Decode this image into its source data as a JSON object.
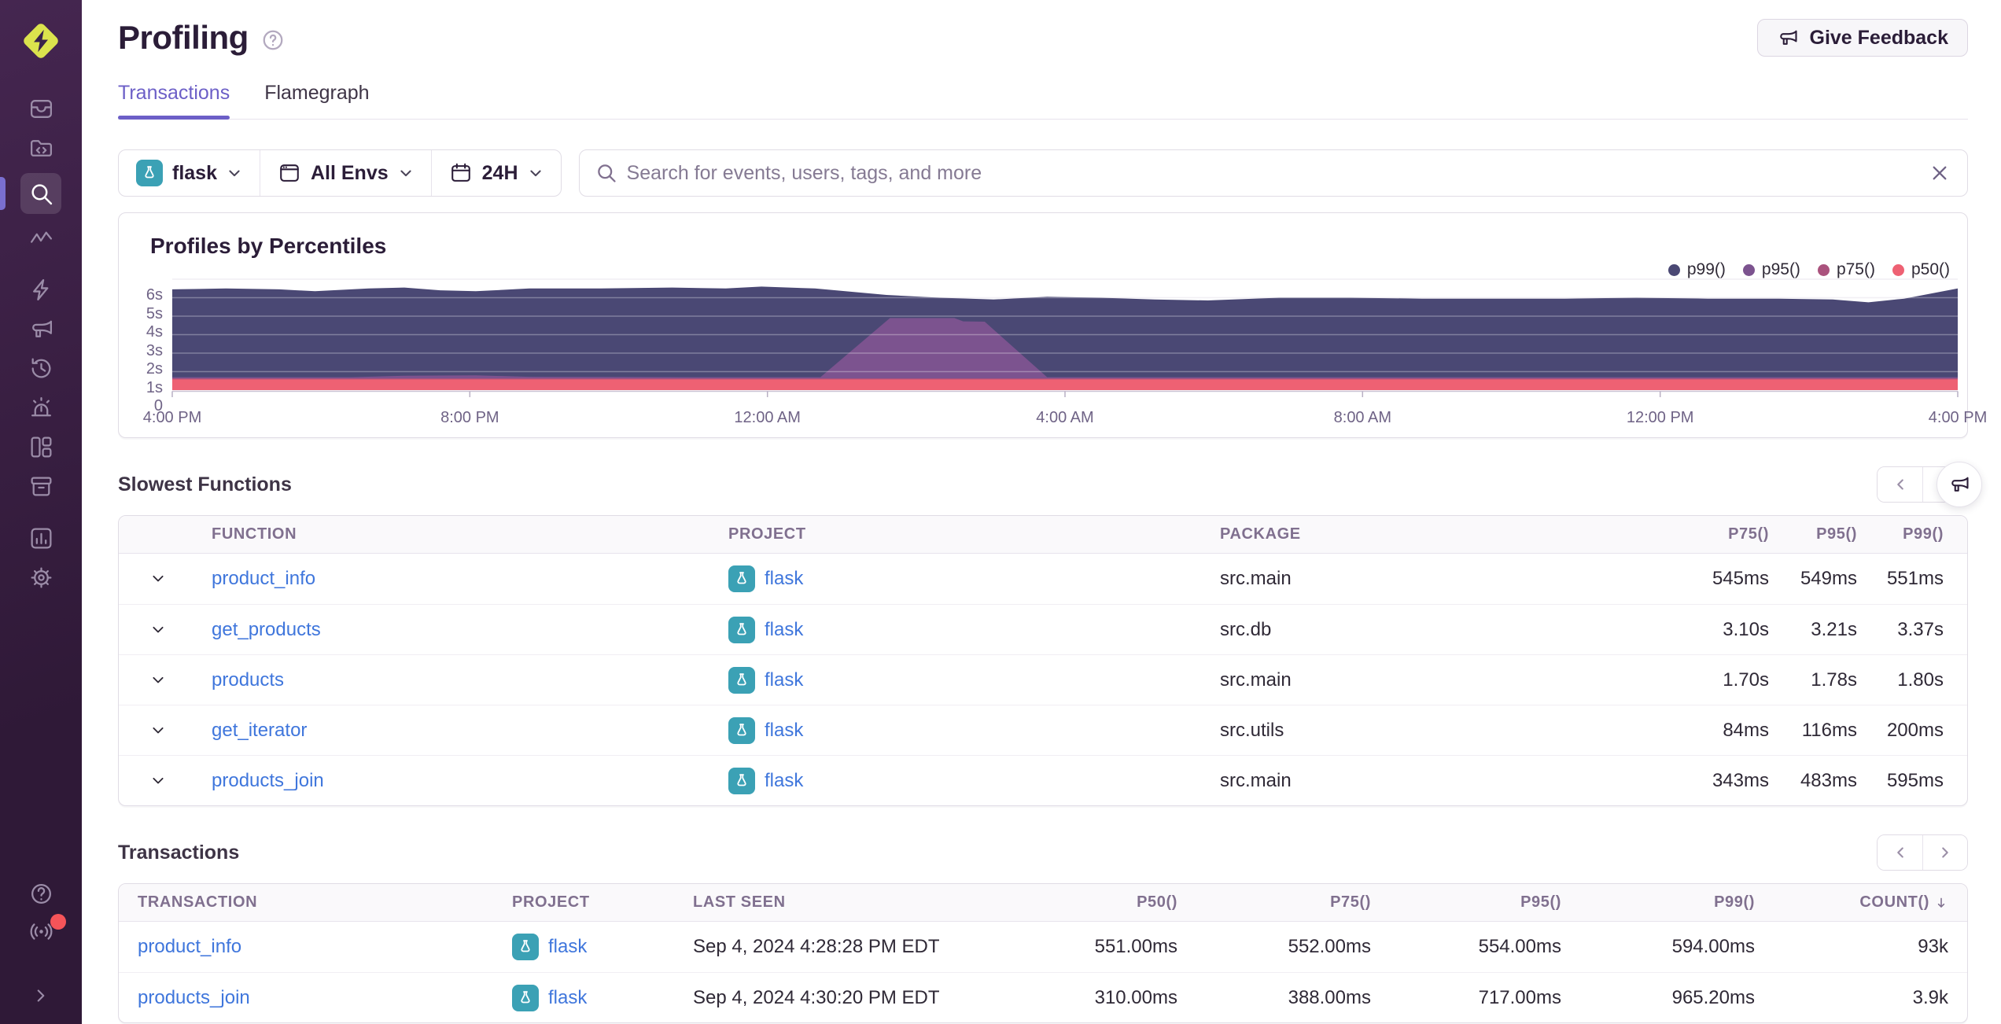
{
  "header": {
    "title": "Profiling",
    "feedback_button": "Give Feedback"
  },
  "tabs": [
    {
      "label": "Transactions",
      "active": true
    },
    {
      "label": "Flamegraph",
      "active": false
    }
  ],
  "filters": {
    "project": "flask",
    "environment": "All Envs",
    "date_range": "24H"
  },
  "search": {
    "placeholder": "Search for events, users, tags, and more"
  },
  "panel": {
    "title": "Profiles by Percentiles"
  },
  "chart_data": {
    "type": "area",
    "title": "Profiles by Percentiles",
    "x_window": "24 hours, 4:00 PM to 4:00 PM",
    "x_ticks": [
      "4:00 PM",
      "8:00 PM",
      "12:00 AM",
      "4:00 AM",
      "8:00 AM",
      "12:00 PM",
      "4:00 PM"
    ],
    "y_ticks": [
      "0",
      "1s",
      "2s",
      "3s",
      "4s",
      "5s",
      "6s"
    ],
    "ylim": [
      0,
      6.3
    ],
    "grid": true,
    "legend_position": "top-right",
    "series": [
      {
        "name": "p99()",
        "color": "#4a4874",
        "pattern": false,
        "points": [
          [
            0,
            5.45
          ],
          [
            0.03,
            5.5
          ],
          [
            0.06,
            5.45
          ],
          [
            0.08,
            5.35
          ],
          [
            0.11,
            5.5
          ],
          [
            0.13,
            5.55
          ],
          [
            0.15,
            5.4
          ],
          [
            0.17,
            5.35
          ],
          [
            0.2,
            5.5
          ],
          [
            0.24,
            5.5
          ],
          [
            0.28,
            5.55
          ],
          [
            0.31,
            5.5
          ],
          [
            0.33,
            5.6
          ],
          [
            0.36,
            5.5
          ],
          [
            0.4,
            5.15
          ],
          [
            0.43,
            5.0
          ],
          [
            0.46,
            4.9
          ],
          [
            0.49,
            5.05
          ],
          [
            0.52,
            5.0
          ],
          [
            0.55,
            4.9
          ],
          [
            0.58,
            4.85
          ],
          [
            0.62,
            5.0
          ],
          [
            0.66,
            5.0
          ],
          [
            0.7,
            4.95
          ],
          [
            0.74,
            4.95
          ],
          [
            0.78,
            4.95
          ],
          [
            0.82,
            5.0
          ],
          [
            0.86,
            4.95
          ],
          [
            0.9,
            4.95
          ],
          [
            0.93,
            4.9
          ],
          [
            0.95,
            4.75
          ],
          [
            0.97,
            4.95
          ],
          [
            1,
            5.5
          ]
        ]
      },
      {
        "name": "p95()",
        "color": "#7c538f",
        "pattern": false,
        "points": [
          [
            0,
            0.7
          ],
          [
            0.1,
            0.7
          ],
          [
            0.13,
            0.78
          ],
          [
            0.17,
            0.8
          ],
          [
            0.2,
            0.72
          ],
          [
            0.3,
            0.7
          ],
          [
            0.363,
            0.7
          ],
          [
            0.402,
            3.9
          ],
          [
            0.438,
            3.9
          ],
          [
            0.443,
            3.72
          ],
          [
            0.455,
            3.7
          ],
          [
            0.49,
            0.7
          ],
          [
            0.6,
            0.7
          ],
          [
            1,
            0.7
          ]
        ]
      },
      {
        "name": "p75()",
        "color": "#aa527d",
        "pattern": true,
        "points": [
          [
            0,
            0.64
          ],
          [
            1,
            0.64
          ]
        ]
      },
      {
        "name": "p50()",
        "color": "#ee6173",
        "pattern": false,
        "points": [
          [
            0,
            0.58
          ],
          [
            1,
            0.58
          ]
        ]
      }
    ]
  },
  "slowest_functions": {
    "heading": "Slowest Functions",
    "columns": [
      "FUNCTION",
      "PROJECT",
      "PACKAGE",
      "P75()",
      "P95()",
      "P99()"
    ],
    "rows": [
      {
        "function": "product_info",
        "project": "flask",
        "package": "src.main",
        "p75": "545ms",
        "p95": "549ms",
        "p99": "551ms"
      },
      {
        "function": "get_products",
        "project": "flask",
        "package": "src.db",
        "p75": "3.10s",
        "p95": "3.21s",
        "p99": "3.37s"
      },
      {
        "function": "products",
        "project": "flask",
        "package": "src.main",
        "p75": "1.70s",
        "p95": "1.78s",
        "p99": "1.80s"
      },
      {
        "function": "get_iterator",
        "project": "flask",
        "package": "src.utils",
        "p75": "84ms",
        "p95": "116ms",
        "p99": "200ms"
      },
      {
        "function": "products_join",
        "project": "flask",
        "package": "src.main",
        "p75": "343ms",
        "p95": "483ms",
        "p99": "595ms"
      }
    ]
  },
  "transactions": {
    "heading": "Transactions",
    "columns": [
      "TRANSACTION",
      "PROJECT",
      "LAST SEEN",
      "P50()",
      "P75()",
      "P95()",
      "P99()",
      "COUNT()"
    ],
    "sorted_by": "COUNT() descending",
    "rows": [
      {
        "transaction": "product_info",
        "project": "flask",
        "last_seen": "Sep 4, 2024 4:28:28 PM EDT",
        "p50": "551.00ms",
        "p75": "552.00ms",
        "p95": "554.00ms",
        "p99": "594.00ms",
        "count": "93k"
      },
      {
        "transaction": "products_join",
        "project": "flask",
        "last_seen": "Sep 4, 2024 4:30:20 PM EDT",
        "p50": "310.00ms",
        "p75": "388.00ms",
        "p95": "717.00ms",
        "p99": "965.20ms",
        "count": "3.9k"
      }
    ]
  },
  "sidebar": {
    "icons": [
      "sentry-logo",
      "issues",
      "projects",
      "explore-search (active)",
      "traces",
      "quick-start-lightning",
      "user-feedback-megaphone",
      "replays-history",
      "alerts-siren",
      "dashboards",
      "releases",
      "stats",
      "settings"
    ],
    "bottom_icons": [
      "help",
      "whats-new-broadcast (red badge)",
      "collapse-chevron"
    ]
  },
  "colors": {
    "accent": "#6c5fc7",
    "sidebar_top": "#452650",
    "sidebar_bottom": "#2f1937",
    "link": "#3f76dc",
    "project_teal": "#3ba1b5",
    "notification_red": "#f55459"
  }
}
